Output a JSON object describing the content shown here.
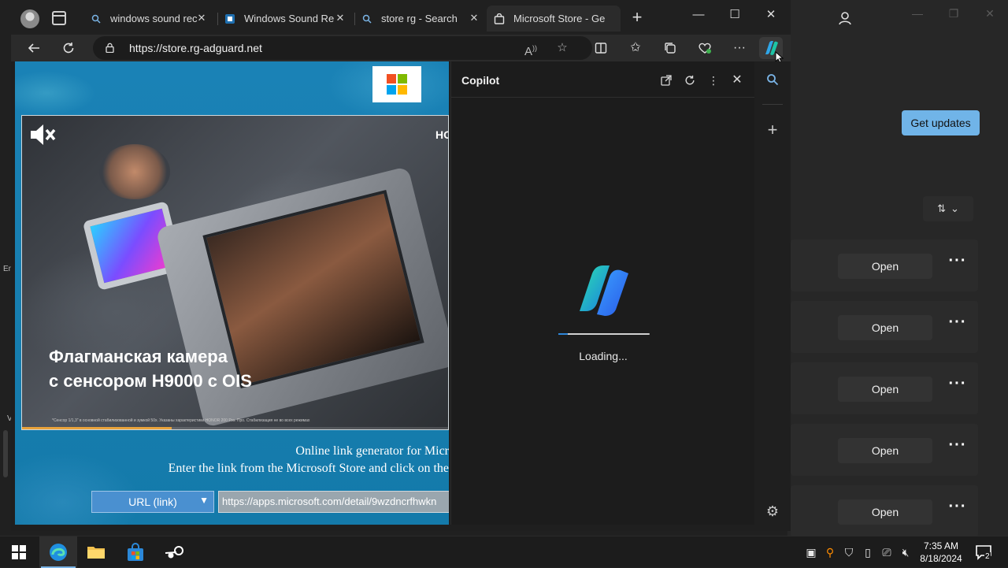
{
  "browser": {
    "tabs": [
      {
        "title": "windows sound rec",
        "icon": "search-icon"
      },
      {
        "title": "Windows Sound Re",
        "icon": "page-icon"
      },
      {
        "title": "store rg - Search",
        "icon": "search-icon"
      },
      {
        "title": "Microsoft Store - Ge",
        "icon": "store-bag-icon",
        "active": true
      }
    ],
    "url": "https://store.rg-adguard.net"
  },
  "page": {
    "ad": {
      "brand": "HO",
      "headline_line1": "Флагманская камера",
      "headline_line2": "с сенсором H9000 с OIS",
      "fine_print": "*Сенсор 1/1,3\" в основной стабилизованной и зумкой 50x. Указаны характеристики HONOR 200 Pro. Про. Стабилизация не во всех режимах",
      "progress": 0.35
    },
    "generator_line1": "Online link generator for Micr",
    "generator_line2": "Enter the link from the Microsoft Store and click on the",
    "url_type_selected": "URL (link)",
    "url_input_value": "https://apps.microsoft.com/detail/9wzdncrfhwkn"
  },
  "copilot": {
    "title": "Copilot",
    "loading_text": "Loading...",
    "loading_progress": 0.1
  },
  "store": {
    "get_updates_label": "Get updates",
    "app_rows": [
      {
        "open_label": "Open"
      },
      {
        "open_label": "Open"
      },
      {
        "open_label": "Open"
      },
      {
        "open_label": "Open"
      },
      {
        "open_label": "Open"
      }
    ]
  },
  "desktop": {
    "snippet1": "En",
    "snippet2": "V"
  },
  "taskbar": {
    "time": "7:35 AM",
    "date": "8/18/2024",
    "notification_count": "2"
  },
  "colors": {
    "accent": "#70b4e8",
    "page_bg": "#1b7cae",
    "copilot_progress": "#2f86d8"
  }
}
